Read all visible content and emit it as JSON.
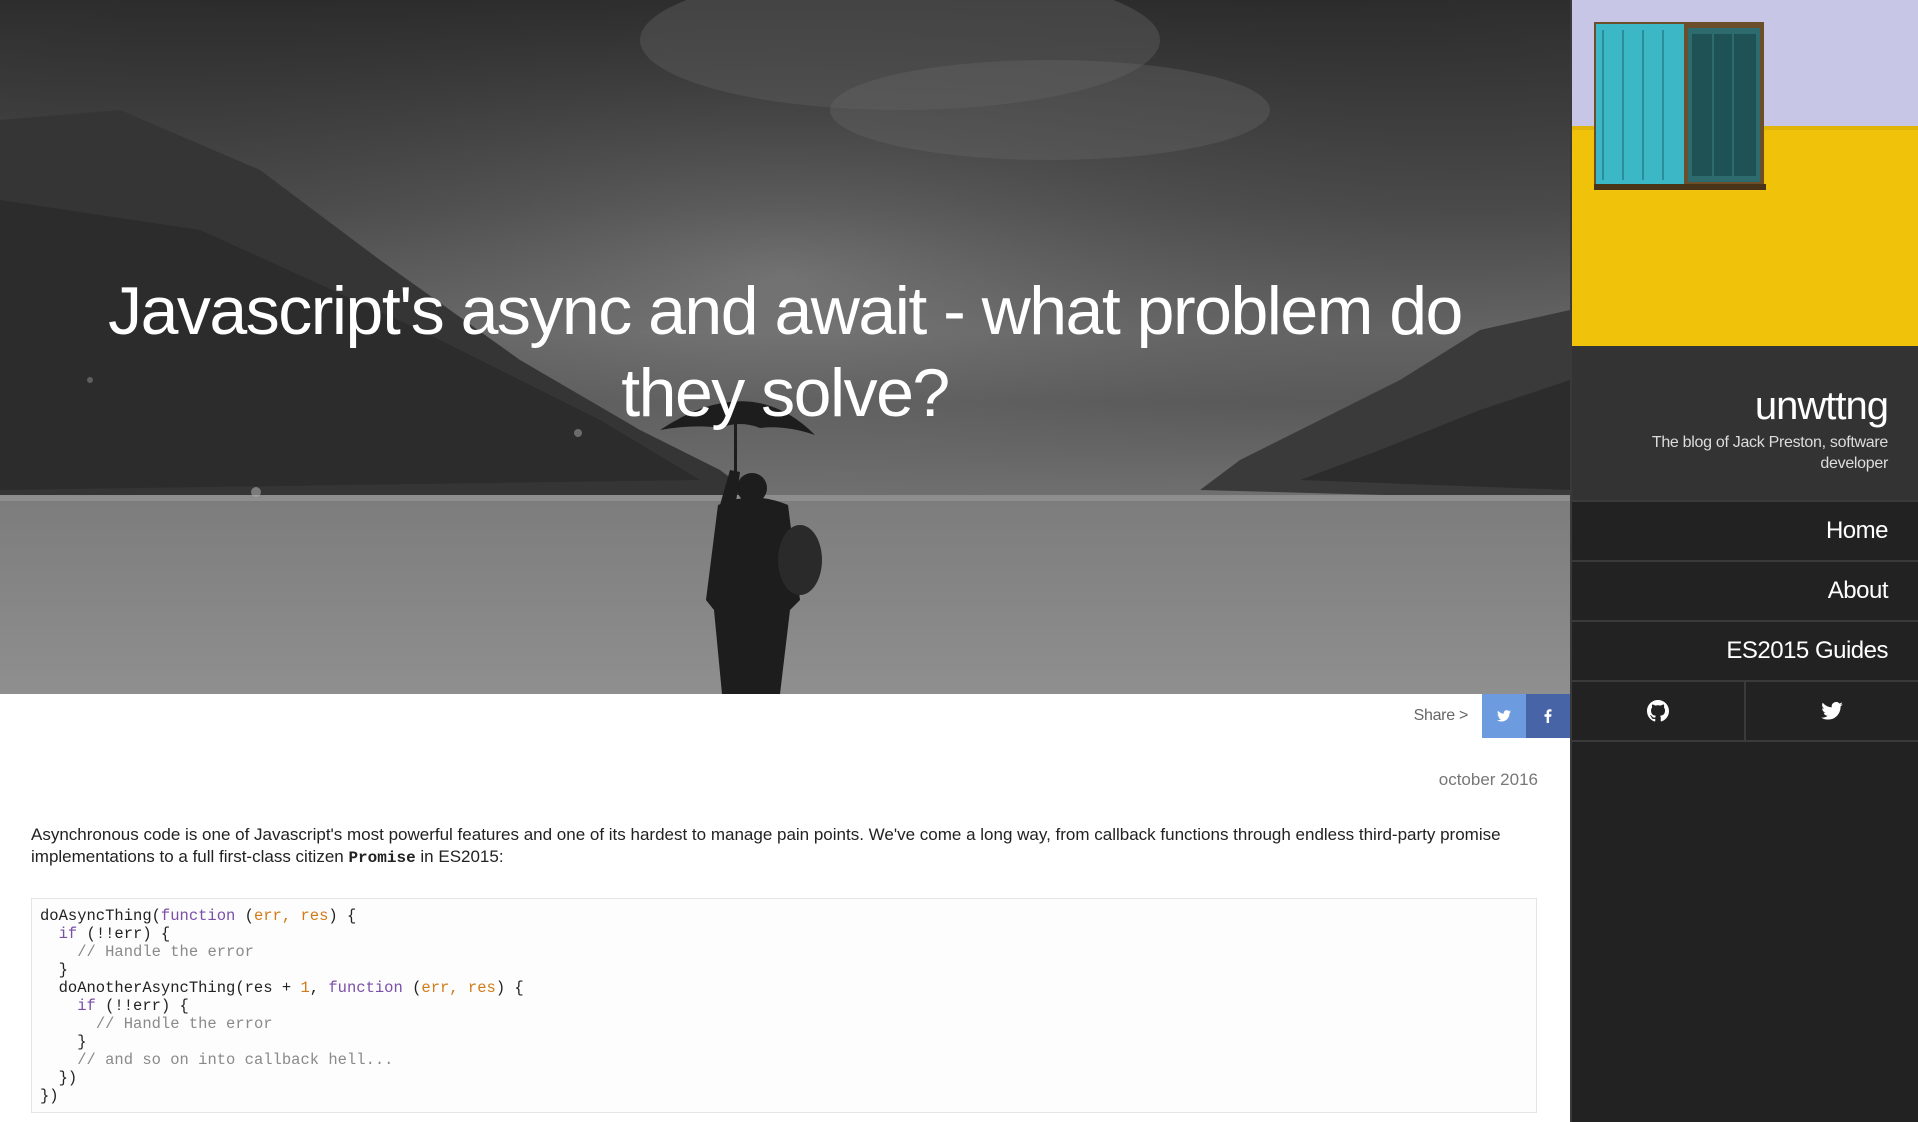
{
  "post": {
    "title": "Javascript's async and await - what problem do they solve?",
    "date": "october 2016",
    "intro_before": "Asynchronous code is one of Javascript's most powerful features and one of its hardest to manage pain points. We've come a long way, from callback functions through endless third-party promise implementations to a full first-class citizen ",
    "intro_code": "Promise",
    "intro_after": " in ES2015:",
    "code_lines": [
      "doAsyncThing(function (err, res) {",
      "  if (!!err) {",
      "    // Handle the error",
      "  }",
      "  doAnotherAsyncThing(res + 1, function (err, res) {",
      "    if (!!err) {",
      "      // Handle the error",
      "    }",
      "    // and so on into callback hell...",
      "  })",
      "})"
    ]
  },
  "share": {
    "label": "Share >",
    "buttons": [
      {
        "name": "twitter",
        "icon": "twitter-icon",
        "color": "#6c9be0"
      },
      {
        "name": "facebook",
        "icon": "facebook-icon",
        "color": "#4764a6"
      }
    ]
  },
  "sidebar": {
    "brand_name": "unwttng",
    "tagline": "The blog of Jack Preston, software developer",
    "nav": [
      {
        "label": "Home"
      },
      {
        "label": "About"
      },
      {
        "label": "ES2015 Guides"
      }
    ],
    "social": [
      {
        "name": "github",
        "icon": "github-icon"
      },
      {
        "name": "twitter",
        "icon": "twitter-icon"
      }
    ]
  },
  "colors": {
    "sidebar_bg": "#222222",
    "brand_bg": "#333333",
    "share_twitter": "#6c9be0",
    "share_facebook": "#4764a6",
    "wall_yellow": "#f0c20a",
    "shutter_teal": "#3bb7c6"
  }
}
